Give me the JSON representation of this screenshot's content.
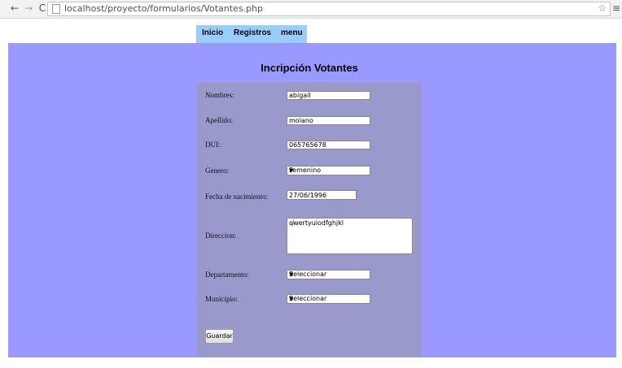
{
  "browser": {
    "url": "localhost/proyecto/formularios/Votantes.php",
    "back_icon": "←",
    "forward_icon": "→",
    "reload_icon": "C",
    "star_icon": "☆",
    "menu_icon": "≡"
  },
  "nav": {
    "inicio": "Inicio",
    "registros": "Registros",
    "menu": "menu"
  },
  "form": {
    "title": "Incripción Votantes",
    "nombres": {
      "label": "Nombres:",
      "value": "abigail"
    },
    "apellido": {
      "label": "Apellido:",
      "value": "molano"
    },
    "dui": {
      "label": "DUI:",
      "value": "065765678"
    },
    "genero": {
      "label": "Genero:",
      "value": "Femenino"
    },
    "fecha": {
      "label": "Fecha de nacimiento:",
      "value": "27/06/1996"
    },
    "direccion": {
      "label": "Direccion:",
      "value": "qwertyuiodfghjkl"
    },
    "departamento": {
      "label": "Departamento:",
      "value": "Seleccionar"
    },
    "municipio": {
      "label": "Municipio:",
      "value": "Seleccionar"
    },
    "guardar": "Guardar"
  },
  "colors": {
    "background": "#9999ff",
    "panel": "#9999cc",
    "menu": "#99ccff"
  }
}
